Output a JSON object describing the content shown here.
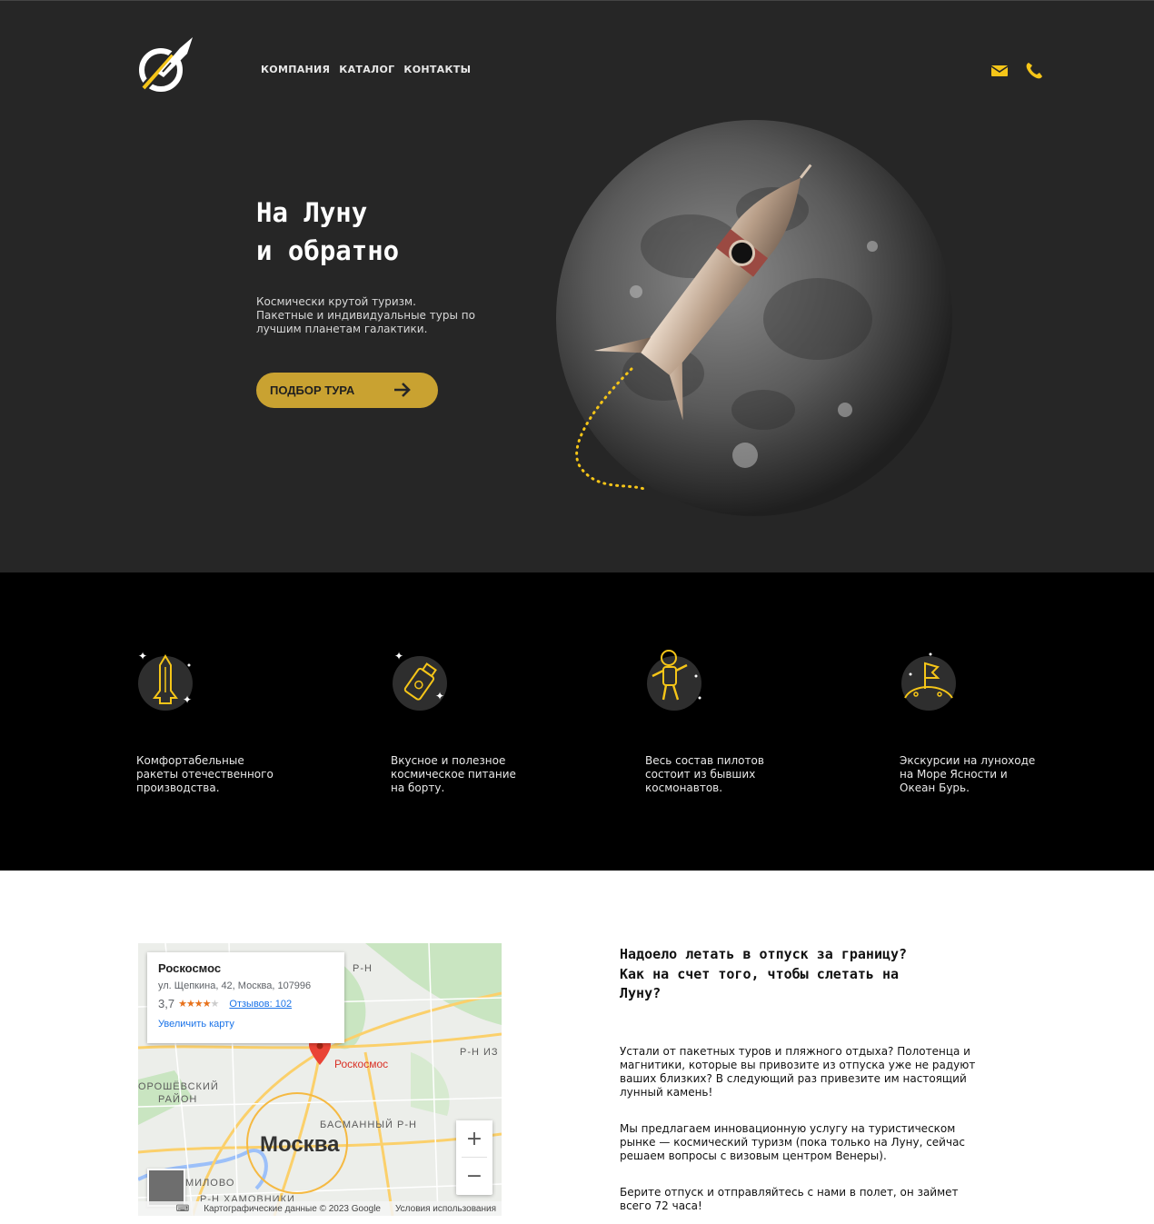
{
  "header": {
    "nav": [
      "КОМПАНИЯ",
      "КАТАЛОГ",
      "КОНТАКТЫ"
    ],
    "icons": {
      "mail": "mail-icon",
      "phone": "phone-icon"
    },
    "accent_color": "#f5c518"
  },
  "hero": {
    "title_lines": [
      "На Луну",
      "и обратно"
    ],
    "subtitle_lines": [
      "Космически крутой туризм.",
      "Пакетные и индивидуальные туры по",
      "лучшим планетам галактики."
    ],
    "cta_label": "ПОДБОР ТУРА",
    "cta_color": "#c9a231"
  },
  "features": [
    {
      "icon": "rocket-icon",
      "lines": [
        "Комфортабельные",
        "ракеты отечественного",
        "производства."
      ]
    },
    {
      "icon": "space-food-icon",
      "lines": [
        "Вкусное и полезное",
        "космическое питание",
        "на борту."
      ]
    },
    {
      "icon": "astronaut-icon",
      "lines": [
        "Весь состав пилотов",
        "состоит из бывших",
        "космонавтов."
      ]
    },
    {
      "icon": "moon-flag-icon",
      "lines": [
        "Экскурсии на луноходе",
        "на Море Ясности и",
        "Океан Бурь."
      ]
    }
  ],
  "map": {
    "place_name": "Роскосмос",
    "address": "ул. Щепкина, 42, Москва, 107996",
    "rating": "3,7",
    "reviews": "Отзывов: 102",
    "enlarge_link": "Увеличить карту",
    "marker_label": "Роскосмос",
    "city_label": "Москва",
    "district_labels": [
      "ОРОШЁВСКИЙ",
      "РАЙОН",
      "БАСМАННЫЙ Р-Н",
      "МИЛОВО",
      "Р-Н ХАМОВНИКИ",
      "Р-Н ИЗ",
      "Р-Н"
    ],
    "footer_data": "Картографические данные © 2023 Google",
    "footer_terms": "Условия использования",
    "zoom_in": "+",
    "zoom_out": "−"
  },
  "about": {
    "title_lines": [
      "Надоело летать в отпуск за границу?",
      "Как на счет того, чтобы слетать на",
      "Луну?"
    ],
    "paragraphs": [
      [
        "Устали от пакетных туров и пляжного отдыха? Полотенца и",
        "магнитики, которые вы привозите из отпуска уже не радуют",
        "ваших близких? В следующий раз привезите им настоящий",
        "лунный камень!"
      ],
      [
        "Мы предлагаем инновационную услугу на туристическом",
        "рынке — космический туризм (пока только на Луну, сейчас",
        "решаем вопросы с визовым центром Венеры)."
      ],
      [
        "Берите отпуск и отправляйтесь с нами в полет, он займет",
        "всего 72 часа!"
      ]
    ]
  }
}
